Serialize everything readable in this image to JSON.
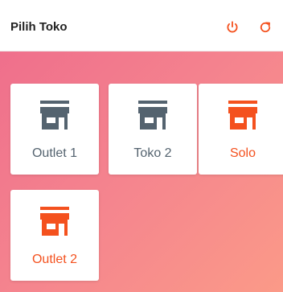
{
  "header": {
    "title": "Pilih Toko",
    "power_icon": "power-icon",
    "refresh_icon": "refresh-icon"
  },
  "colors": {
    "accent": "#f4511e",
    "store_grey": "#54636f",
    "background_start": "#ef6f8c",
    "background_end": "#fb9a88"
  },
  "stores": [
    {
      "label": "Outlet 1",
      "icon": "store-icon",
      "color": "#54636f"
    },
    {
      "label": "Toko 2",
      "icon": "store-icon",
      "color": "#54636f"
    },
    {
      "label": "Solo",
      "icon": "store-icon",
      "color": "#f4511e"
    },
    {
      "label": "Outlet 2",
      "icon": "store-icon",
      "color": "#f4511e"
    }
  ]
}
